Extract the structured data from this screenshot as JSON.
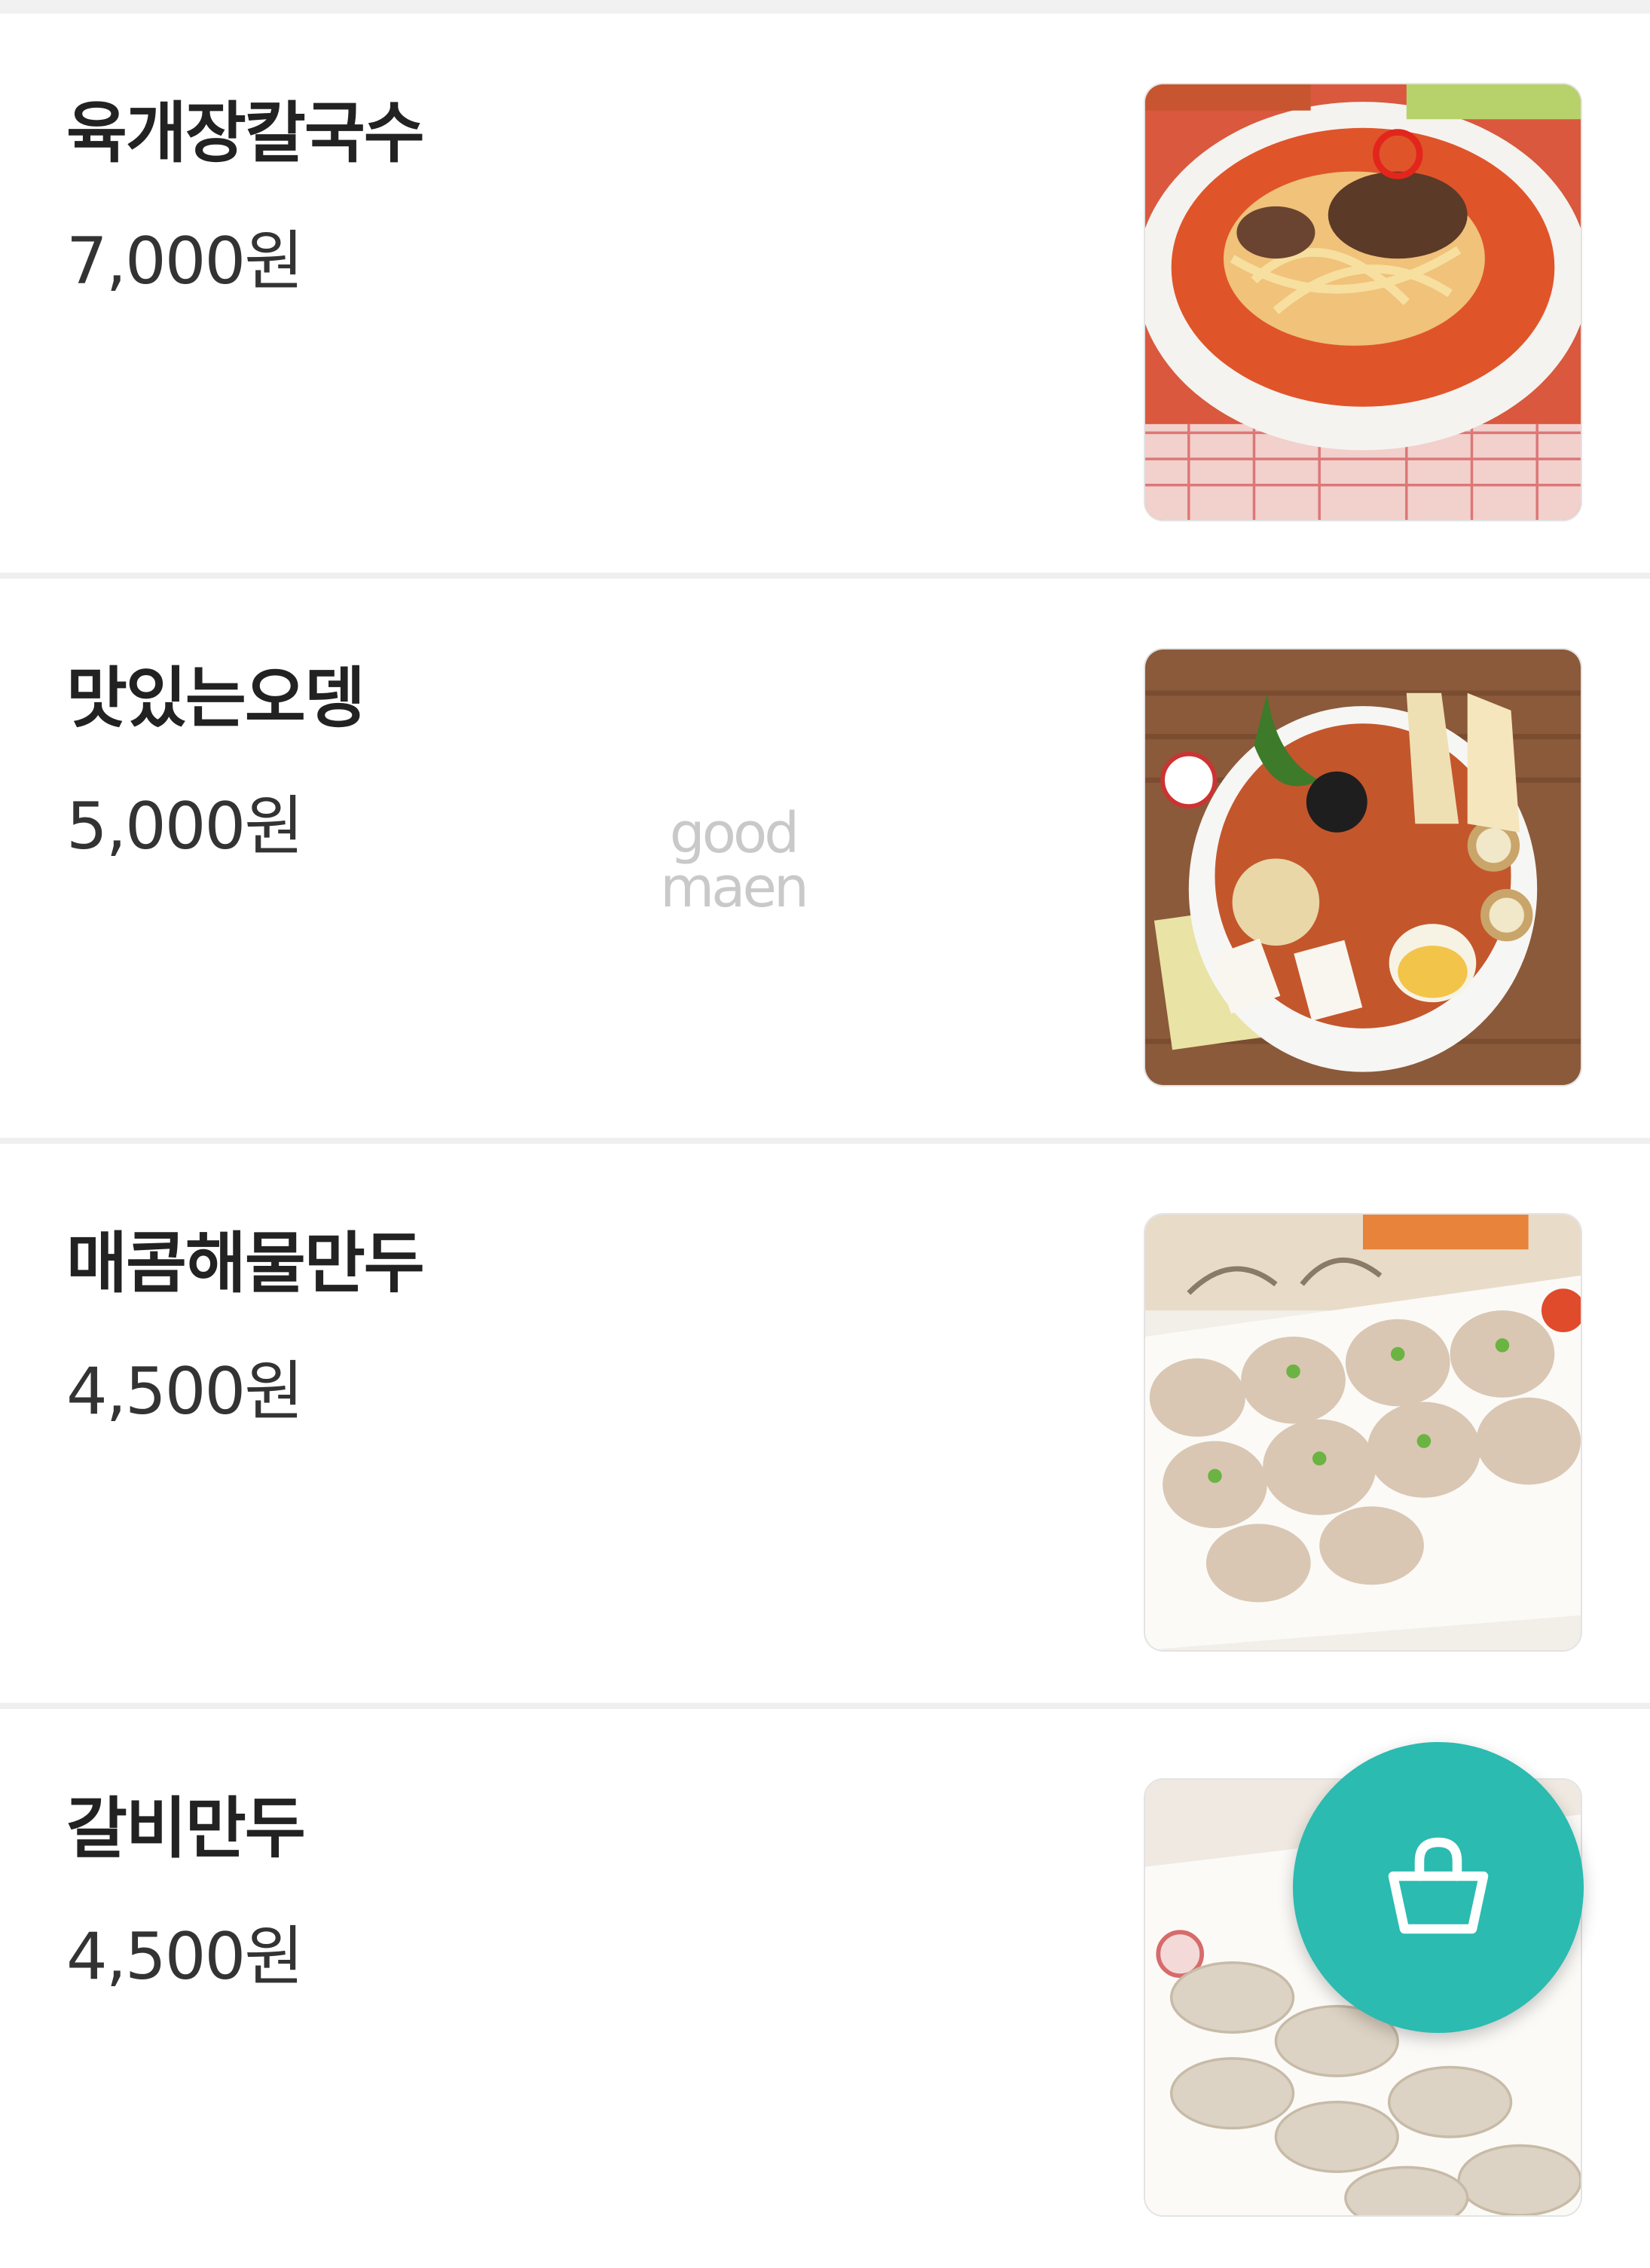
{
  "menu": {
    "items": [
      {
        "name": "육개장칼국수",
        "price": "7,000원",
        "image": "spicy-beef-noodle-soup"
      },
      {
        "name": "맛있는오뎅",
        "price": "5,000원",
        "image": "fish-cake-soup"
      },
      {
        "name": "매콤해물만두",
        "price": "4,500원",
        "image": "spicy-seafood-dumplings"
      },
      {
        "name": "갈비만두",
        "price": "4,500원",
        "image": "galbi-dumplings"
      }
    ]
  },
  "watermark": {
    "line1": "good",
    "line2": "maen"
  },
  "cart_button": {
    "icon": "shopping-basket-icon",
    "color": "#2bbbb0"
  }
}
